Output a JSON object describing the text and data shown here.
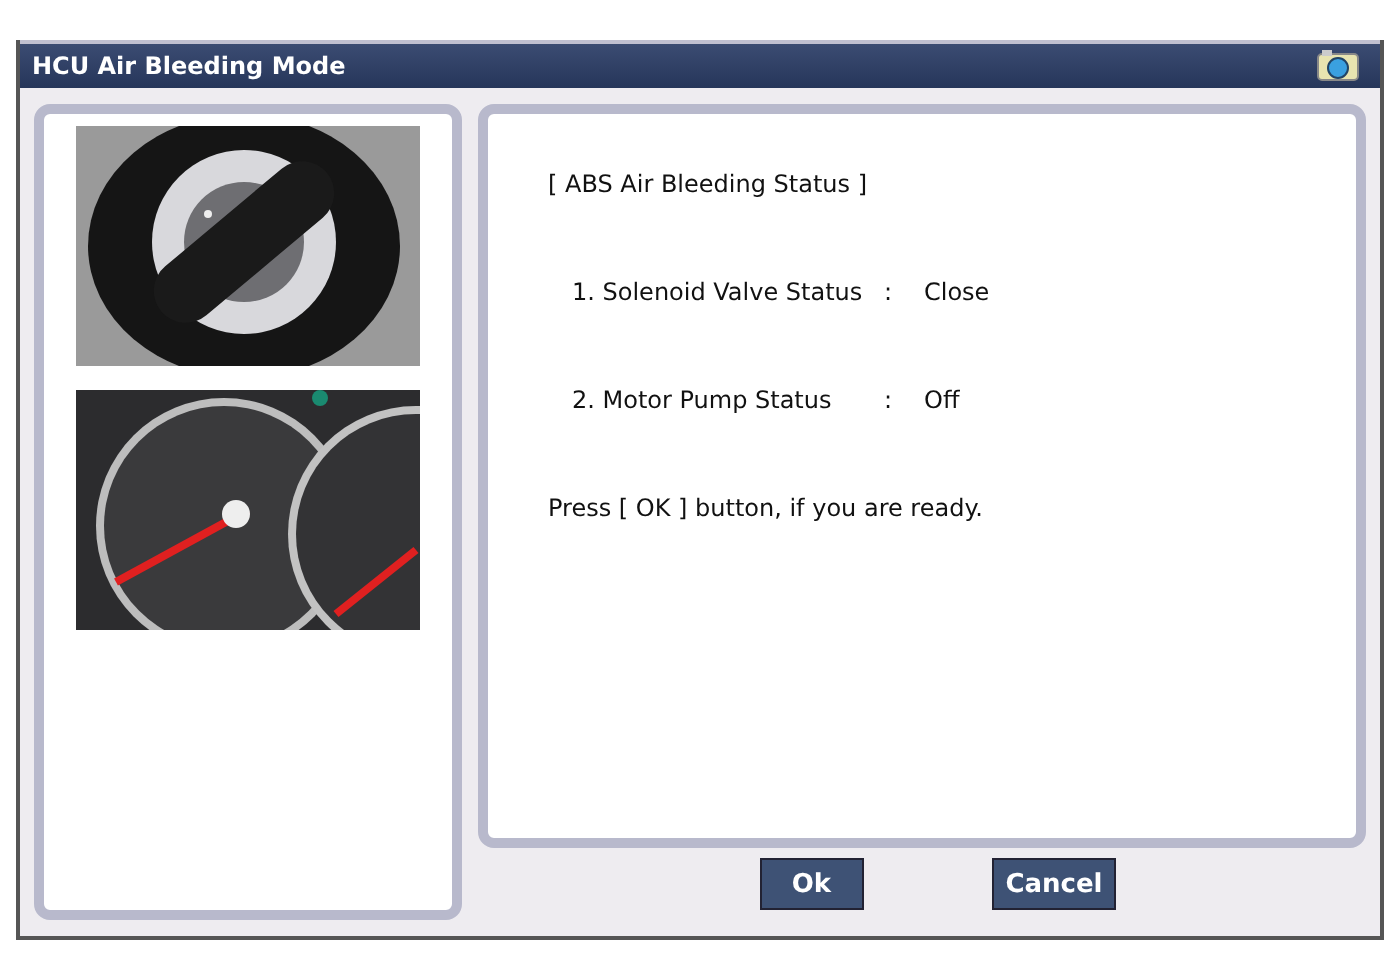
{
  "window": {
    "title": "HCU Air Bleeding Mode"
  },
  "status": {
    "heading": "[ ABS Air Bleeding Status ]",
    "items": [
      {
        "label": "1. Solenoid Valve Status",
        "separator": ":",
        "value": "Close"
      },
      {
        "label": "2. Motor Pump Status",
        "separator": ":",
        "value": "Off"
      }
    ],
    "prompt": "Press [ OK ] button, if you are ready."
  },
  "buttons": [
    "Ok",
    "Cancel"
  ]
}
